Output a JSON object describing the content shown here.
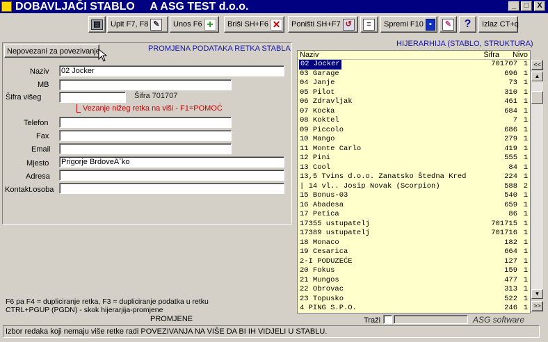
{
  "window": {
    "title": "DOBAVLJAČI STABLO     A ASG TEST d.o.o.",
    "minimize": "_",
    "maximize": "□",
    "close": "X"
  },
  "toolbar": {
    "print_icon": "printer-icon",
    "items": [
      {
        "label": "Upit F7, F8",
        "icon": "query-icon"
      },
      {
        "label": "Unos F6",
        "icon": "add-icon"
      },
      {
        "label": "Briši  SH+F6",
        "icon": "delete-icon"
      },
      {
        "label": "Poništi SH+F7",
        "icon": "undo-icon"
      },
      {
        "label": "Spremi F10",
        "icon": "save-icon"
      },
      {
        "label": "",
        "icon": "edit-icon"
      },
      {
        "label": "?",
        "icon": "help-icon"
      },
      {
        "label": "Izlaz CT+q",
        "icon": ""
      }
    ]
  },
  "form": {
    "unlinked_button": "Nepovezani za povezivanje",
    "header": "PROMJENA PODATAKA RETKA STABLA",
    "naziv_label": "Naziv",
    "naziv_value": "02 Jocker",
    "mb_label": "MB",
    "mb_value": "",
    "sifra_viseg_label": "Šifra višeg",
    "sifra_viseg_value": "",
    "sifra_text": "Šifra 701707",
    "hint": "Vezanje nižeg retka na viši - F1=POMOĆ",
    "telefon_label": "Telefon",
    "telefon_value": "",
    "fax_label": "Fax",
    "fax_value": "",
    "email_label": "Email",
    "email_value": "",
    "mjesto_label": "Mjesto",
    "mjesto_value": "Prigorje BrdoveÄˇko",
    "adresa_label": "Adresa",
    "adresa_value": "",
    "kontakt_label": "Kontakt.osoba",
    "kontakt_value": ""
  },
  "bottom_left": {
    "help_line1": "F6 pa F4 = dupliciranje retka, F3 = dupliciranje podatka u retku",
    "help_line2": "CTRL+PGUP (PGDN) - skok hijerarjija-promjene",
    "mode": "PROMJENE"
  },
  "tree": {
    "header": "HIJERARHIJA (STABLO, STRUKTURA)",
    "col_naziv": "Naziv",
    "col_sifra": "Šifra",
    "col_nivo": "Nivo",
    "rows": [
      {
        "name": "02 Jocker",
        "sifra": "701707",
        "nivo": "1",
        "selected": true
      },
      {
        "name": "03  Garage",
        "sifra": "696",
        "nivo": "1"
      },
      {
        "name": "04 Janje",
        "sifra": "73",
        "nivo": "1"
      },
      {
        "name": "05 Pilot",
        "sifra": "310",
        "nivo": "1"
      },
      {
        "name": "06 Zdravljak",
        "sifra": "461",
        "nivo": "1"
      },
      {
        "name": "07 Kocka",
        "sifra": "684",
        "nivo": "1"
      },
      {
        "name": "08 Koktel",
        "sifra": "7",
        "nivo": "1"
      },
      {
        "name": "09 Piccolo",
        "sifra": "686",
        "nivo": "1"
      },
      {
        "name": "10 Mango",
        "sifra": "279",
        "nivo": "1"
      },
      {
        "name": "11 Monte Carlo",
        "sifra": "419",
        "nivo": "1"
      },
      {
        "name": "12 Pini",
        "sifra": "555",
        "nivo": "1"
      },
      {
        "name": "13 Cool",
        "sifra": "84",
        "nivo": "1"
      },
      {
        "name": "13,5 Tvins d.o.o. Zanatsko Štedna Kred",
        "sifra": "224",
        "nivo": "1"
      },
      {
        "name": "| 14 vl.. Josip Novak (Scorpion)",
        "sifra": "588",
        "nivo": "2"
      },
      {
        "name": "15 Bonus-03",
        "sifra": "540",
        "nivo": "1"
      },
      {
        "name": "16 Abadesa",
        "sifra": "659",
        "nivo": "1"
      },
      {
        "name": "17 Petica",
        "sifra": "86",
        "nivo": "1"
      },
      {
        "name": "17355 ustupatelj",
        "sifra": "701715",
        "nivo": "1"
      },
      {
        "name": "17389 ustupatelj",
        "sifra": "701716",
        "nivo": "1"
      },
      {
        "name": "18 Monaco",
        "sifra": "182",
        "nivo": "1"
      },
      {
        "name": "19 Cesarica",
        "sifra": "664",
        "nivo": "1"
      },
      {
        "name": "2-I PODUZEĆE",
        "sifra": "127",
        "nivo": "1"
      },
      {
        "name": "20 Fokus",
        "sifra": "159",
        "nivo": "1"
      },
      {
        "name": "21 Mungos",
        "sifra": "477",
        "nivo": "1"
      },
      {
        "name": "22 Obrovac",
        "sifra": "313",
        "nivo": "1"
      },
      {
        "name": "23 Topusko",
        "sifra": "522",
        "nivo": "1"
      },
      {
        "name": "4 PING S.P.O.",
        "sifra": "246",
        "nivo": "1"
      }
    ],
    "prev_page": "<<",
    "next_page": ">>",
    "trazi_label": "Traži",
    "trazi_value": "",
    "brand": "ASG software"
  },
  "status": {
    "text": "Izbor redaka koji nemaju više retke radi POVEZIVANJA NA VIŠE DA BI IH VIDJELI U STABLU."
  }
}
